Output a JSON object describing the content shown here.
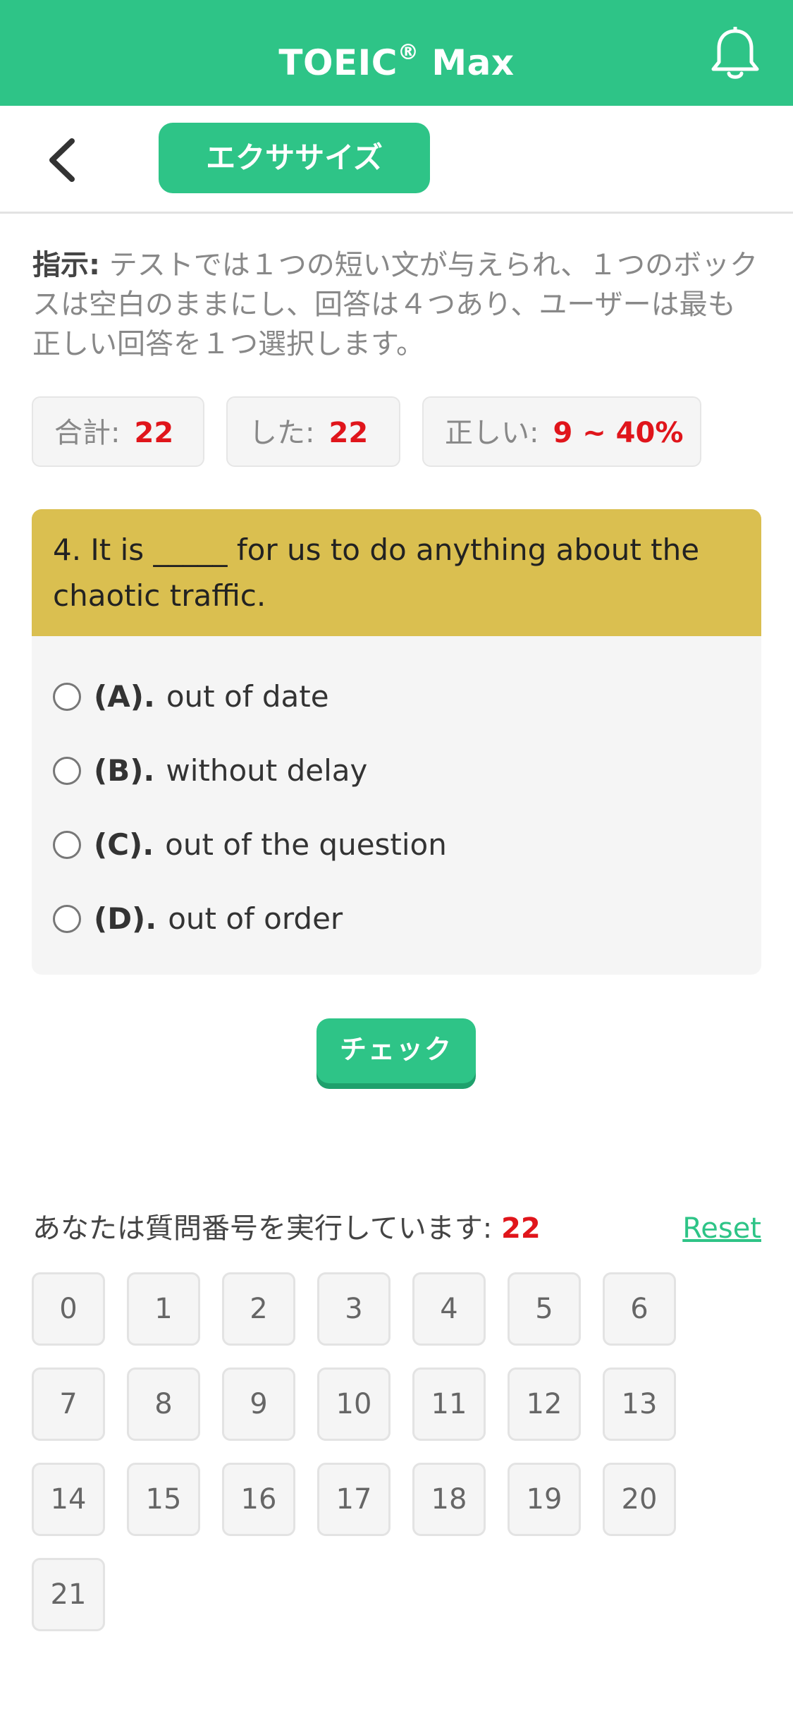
{
  "header": {
    "title": "TOEIC",
    "title_mark": "®",
    "title_suffix": " Max"
  },
  "subbar": {
    "tab_label": "エクササイズ"
  },
  "instruction": {
    "label": "指示:",
    "text": " テストでは１つの短い文が与えられ、１つのボックスは空白のままにし、回答は４つあり、ユーザーは最も正しい回答を１つ選択します。"
  },
  "stats": {
    "total_label": "合計:",
    "total_value": "22",
    "done_label": "した:",
    "done_value": "22",
    "correct_label": "正しい:",
    "correct_value": "9 ~ 40%"
  },
  "question": {
    "text": "4. It is _____ for us to do anything about the chaotic traffic.",
    "options": [
      {
        "label": "(A).",
        "text": "out of date"
      },
      {
        "label": "(B).",
        "text": "without delay"
      },
      {
        "label": "(C).",
        "text": "out of the question"
      },
      {
        "label": "(D).",
        "text": "out of order"
      }
    ]
  },
  "check_label": "チェック",
  "progress": {
    "label": "あなたは質問番号を実行しています:",
    "value": "22",
    "reset_label": "Reset"
  },
  "numbers": [
    "0",
    "1",
    "2",
    "3",
    "4",
    "5",
    "6",
    "7",
    "8",
    "9",
    "10",
    "11",
    "12",
    "13",
    "14",
    "15",
    "16",
    "17",
    "18",
    "19",
    "20",
    "21"
  ],
  "colors": {
    "brand": "#2ec487",
    "question_header": "#dabf50",
    "highlight": "#e0151b"
  },
  "icons": {
    "notification": "bell-icon",
    "back": "chevron-left-icon"
  }
}
